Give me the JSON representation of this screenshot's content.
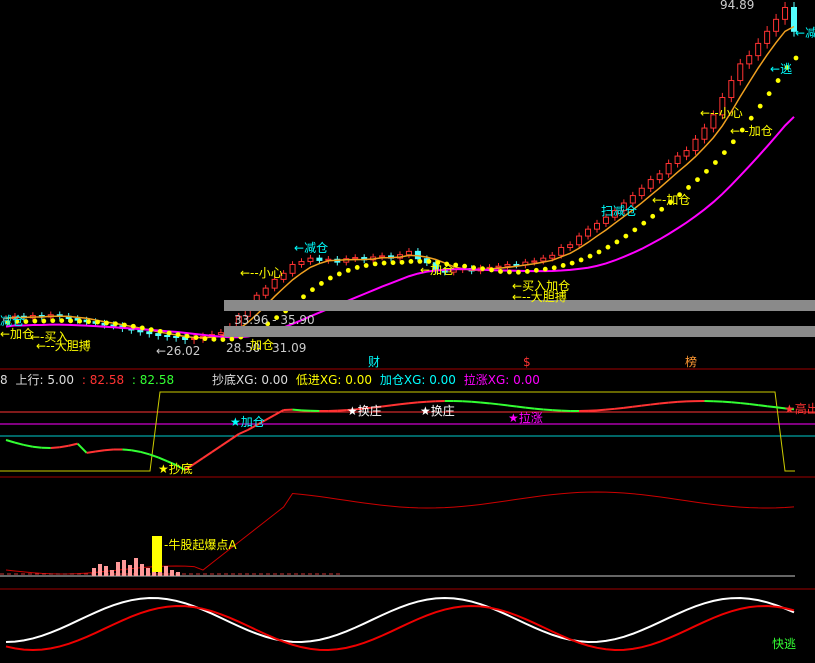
{
  "top_price": "94.89",
  "zones": {
    "upper": {
      "label": "33.96 - 35.90"
    },
    "lower": {
      "low": "28.50",
      "mid": "加仓",
      "high": "31.09"
    }
  },
  "low_marker": "26.02",
  "price_labels": [
    {
      "text": "减仓",
      "color": "#00ffff",
      "pos": "left-edge"
    },
    {
      "text": "←加仓",
      "color": "#ffff00",
      "pos": "left-edge"
    },
    {
      "text": "买入",
      "color": "#ffff00",
      "pos": "left"
    },
    {
      "text": "大胆搏",
      "color": "#ffff00",
      "pos": "left"
    },
    {
      "text": "小心",
      "color": "#ffff00",
      "pos": "mid"
    },
    {
      "text": "减仓",
      "color": "#00ffff",
      "pos": "mid"
    },
    {
      "text": "加仓",
      "color": "#ffff00",
      "pos": "mid"
    },
    {
      "text": "买入加仓",
      "color": "#ffff00",
      "pos": "mid"
    },
    {
      "text": "大胆搏",
      "color": "#ffff00",
      "pos": "mid"
    },
    {
      "text": "扫减仓",
      "color": "#00ffff",
      "pos": "right"
    },
    {
      "text": "加仓",
      "color": "#ffff00",
      "pos": "right"
    },
    {
      "text": "小心",
      "color": "#ffff00",
      "pos": "right"
    },
    {
      "text": "加仓",
      "color": "#ffff00",
      "pos": "right"
    },
    {
      "text": "逃",
      "color": "#00ffff",
      "pos": "right"
    },
    {
      "text": "减",
      "color": "#00ffff",
      "pos": "right"
    }
  ],
  "events": [
    {
      "text": "财",
      "color": "#00ffff"
    },
    {
      "text": "$",
      "color": "#ff3333"
    },
    {
      "text": "榜",
      "color": "#ff9933"
    }
  ],
  "indicator_bar": {
    "prefix": "8",
    "up_label": "上行: 5.00",
    "colon_red": ": 82.58",
    "colon_green": ": 82.58",
    "chao_di": "抄底XG: 0.00",
    "di_jin": "低进XG: 0.00",
    "jia_cang": "加仓XG: 0.00",
    "la_zhang": "拉涨XG: 0.00"
  },
  "osc_labels": {
    "jia_cang": "加仓",
    "di_jin": "抄底",
    "huan_zhuang_1": "换庄",
    "huan_zhuang_2": "换庄",
    "la_zhang": "拉涨",
    "gao_chu": "高出"
  },
  "volume_label": "牛股起爆点A",
  "bottom_label": "快逃",
  "colors": {
    "up": "#ff3333",
    "down": "#54ffff",
    "ma_orange": "#f0a020",
    "ma_magenta": "#ff00ff",
    "dots": "#ffff00",
    "grid_red": "#aa0000"
  },
  "chart_data": {
    "type": "candlestick",
    "close": [
      29.2,
      29.5,
      29.3,
      29.6,
      29.4,
      29.7,
      29.5,
      29.2,
      29.0,
      28.8,
      28.6,
      28.4,
      28.3,
      28.0,
      27.8,
      27.6,
      27.4,
      27.2,
      27.1,
      27.0,
      26.8,
      26.9,
      27.1,
      27.3,
      27.5,
      28.2,
      29.5,
      31.0,
      32.5,
      33.6,
      35.0,
      36.0,
      37.5,
      38.0,
      38.6,
      38.2,
      38.4,
      37.9,
      38.5,
      38.7,
      38.3,
      38.8,
      39.0,
      38.6,
      39.2,
      39.8,
      38.5,
      37.8,
      36.5,
      36.2,
      36.6,
      36.8,
      36.4,
      36.9,
      37.0,
      37.2,
      37.5,
      37.4,
      37.9,
      38.1,
      38.6,
      39.1,
      40.5,
      41.0,
      42.6,
      43.9,
      45.0,
      46.2,
      47.5,
      49.0,
      50.5,
      52.0,
      53.8,
      55.0,
      57.2,
      58.8,
      60.0,
      62.5,
      65.0,
      68.0,
      72.0,
      76.0,
      80.0,
      82.0,
      85.0,
      88.0,
      91.0,
      94.0,
      88.0
    ],
    "ymax": 94.89,
    "ymin": 26.02
  }
}
